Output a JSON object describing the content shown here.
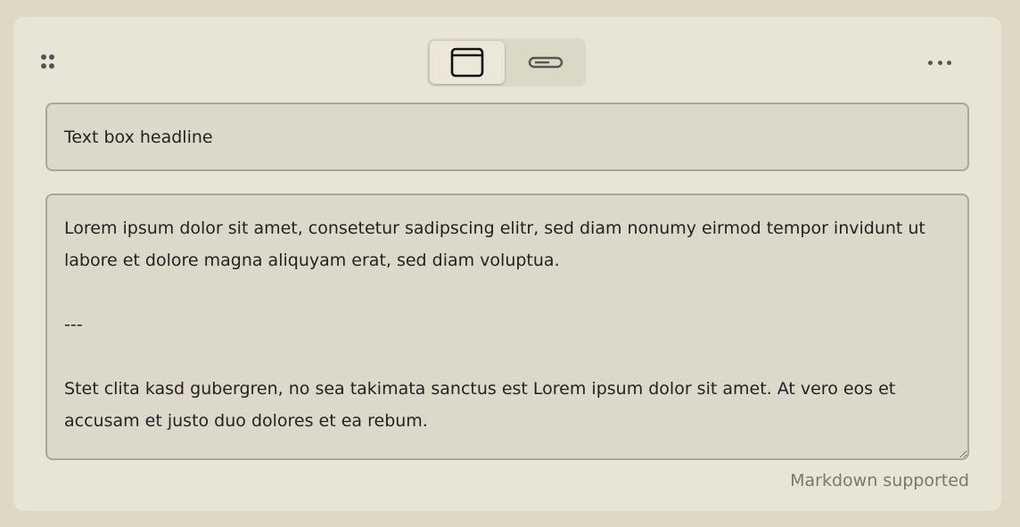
{
  "editor": {
    "headline_value": "Text box headline",
    "body_value": "Lorem ipsum dolor sit amet, consetetur sadipscing elitr, sed diam nonumy eirmod tempor invidunt ut labore et dolore magna aliquyam erat, sed diam voluptua.\n\n---\n\nStet clita kasd gubergren, no sea takimata sanctus est Lorem ipsum dolor sit amet. At vero eos et accusam et justo duo dolores et ea rebum.",
    "hint": "Markdown supported"
  },
  "toolbar": {
    "drag_icon": "drag-handle-icon",
    "layout_options": [
      {
        "icon": "window-layout-icon",
        "selected": true
      },
      {
        "icon": "bar-layout-icon",
        "selected": false
      }
    ],
    "more_icon": "more-horizontal-icon"
  },
  "colors": {
    "page_bg": "#ddd9c5",
    "card_bg": "#e8e5d6",
    "field_bg": "#dcd9ca",
    "field_border": "#a9a797",
    "hint_text": "#7a786c"
  }
}
